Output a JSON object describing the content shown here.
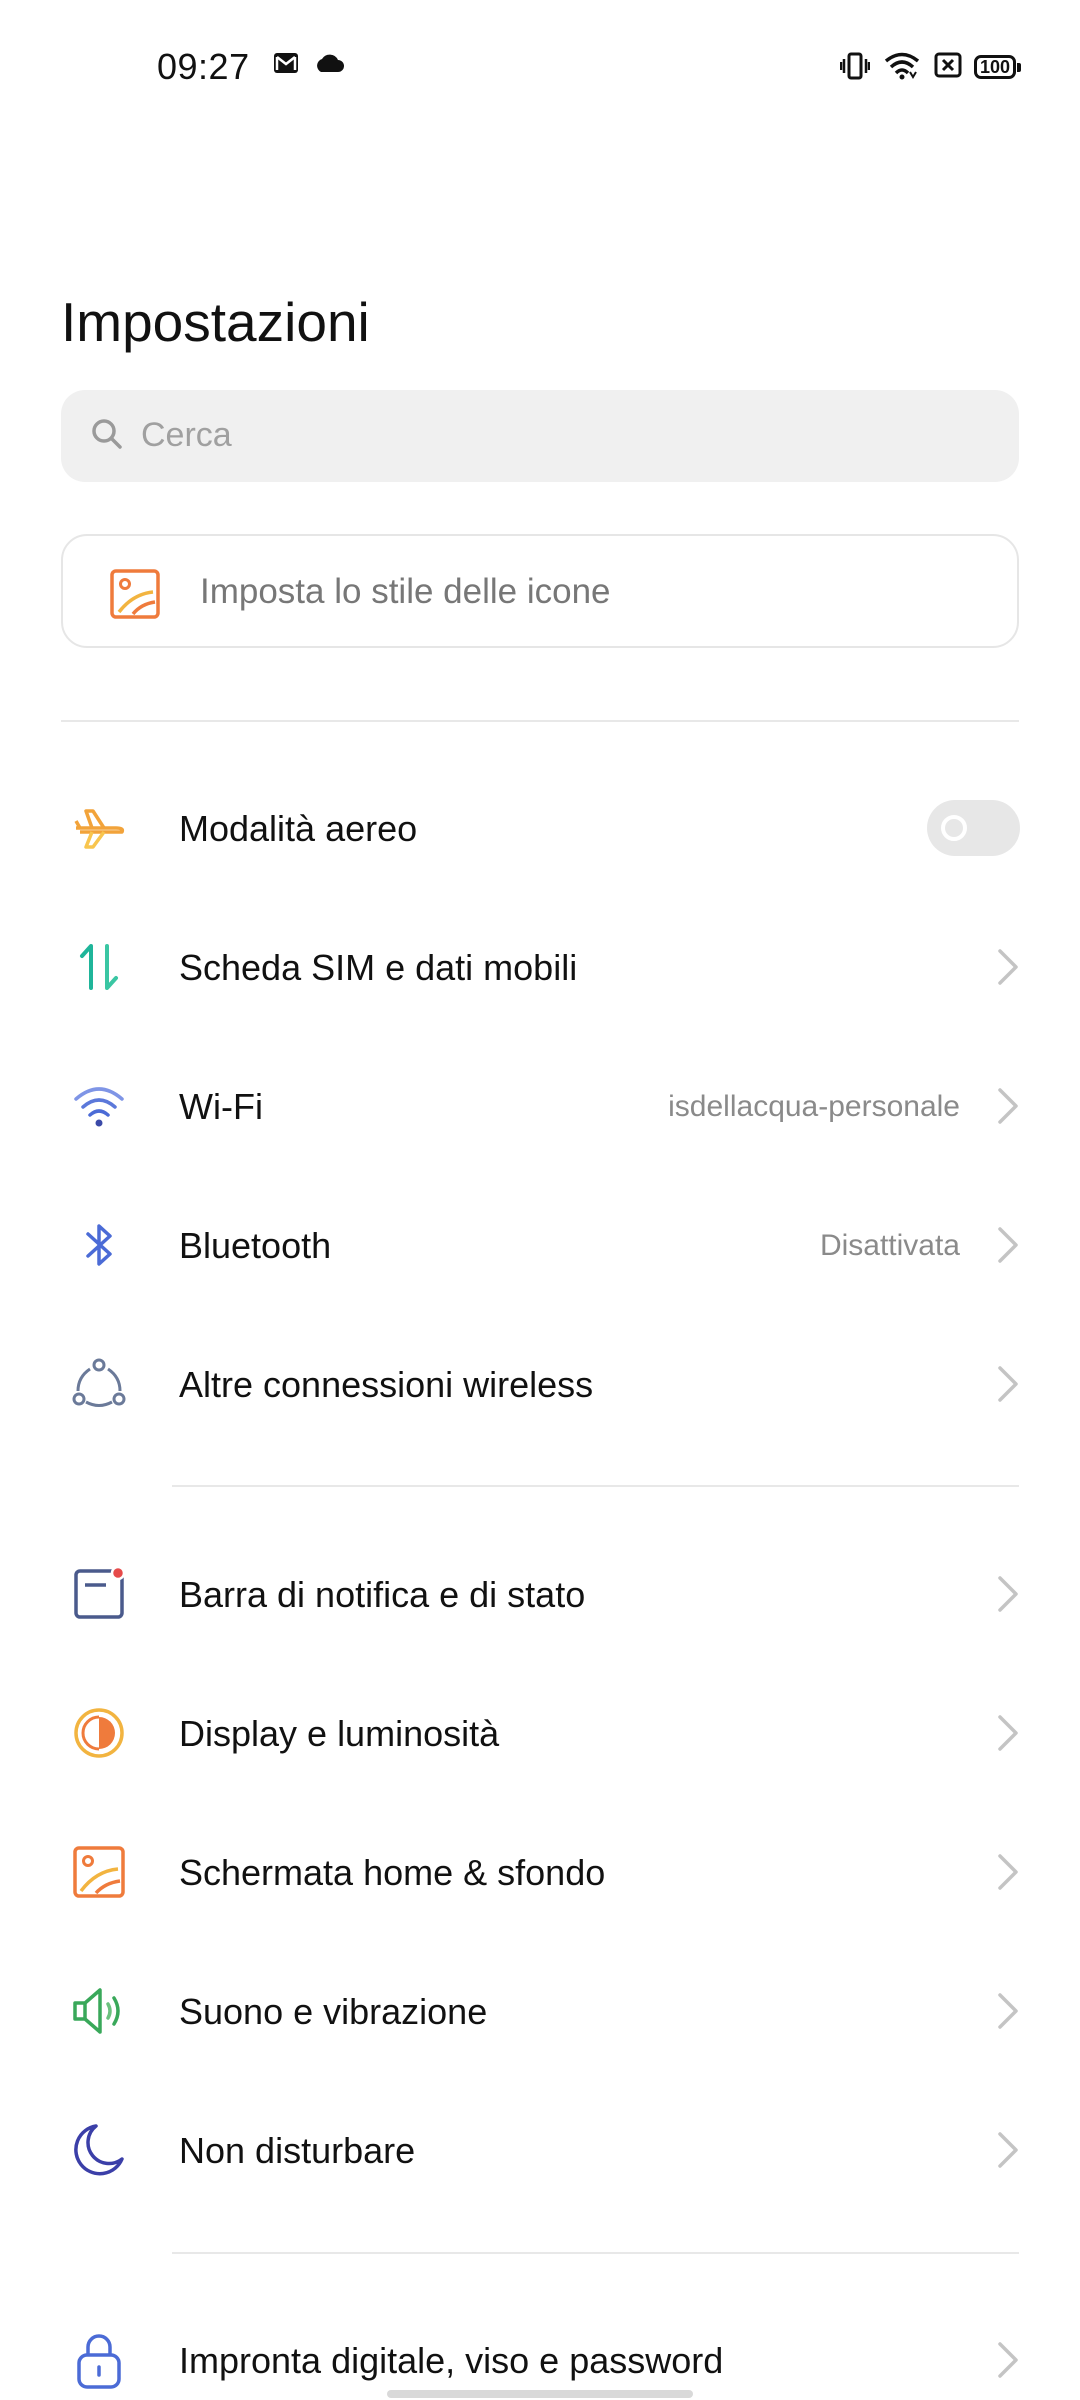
{
  "status_bar": {
    "time": "09:27",
    "left_icons": [
      "gmail-icon",
      "cloud-icon"
    ],
    "right_icons": [
      "vibrate-icon",
      "wifi-icon",
      "no-sim-icon",
      "battery-icon"
    ],
    "battery": "100"
  },
  "header": {
    "title": "Impostazioni"
  },
  "search": {
    "placeholder": "Cerca"
  },
  "icon_style_card": {
    "label": "Imposta lo stile delle icone",
    "icon": "wallpaper-icon"
  },
  "settings": {
    "group1": [
      {
        "label": "Modalità aereo",
        "icon": "airplane-icon",
        "toggle_on": false,
        "icon_color": "#f2a33a"
      },
      {
        "label": "Scheda SIM e dati mobili",
        "icon": "data-transfer-icon",
        "icon_color": "#1fb59a"
      },
      {
        "label": "Wi-Fi",
        "value": "isdellacqua-personale",
        "icon": "wifi-icon",
        "icon_color": "#4b6bd6"
      },
      {
        "label": "Bluetooth",
        "value": "Disattivata",
        "icon": "bluetooth-icon",
        "icon_color": "#4b6bd6"
      },
      {
        "label": "Altre connessioni wireless",
        "icon": "connections-icon",
        "icon_color": "#6b7a99"
      }
    ],
    "group2": [
      {
        "label": "Barra di notifica e di stato",
        "icon": "notification-bar-icon",
        "icon_color": "#4a5a8c"
      },
      {
        "label": "Display e luminosità",
        "icon": "brightness-icon",
        "icon_color": "#f0a030"
      },
      {
        "label": "Schermata home & sfondo",
        "icon": "wallpaper-icon",
        "icon_color": "#ef7b3c"
      },
      {
        "label": "Suono e vibrazione",
        "icon": "speaker-icon",
        "icon_color": "#39a85a"
      },
      {
        "label": "Non disturbare",
        "icon": "moon-icon",
        "icon_color": "#3b3fa8"
      }
    ],
    "group3": [
      {
        "label": "Impronta digitale, viso e password",
        "icon": "lock-icon",
        "icon_color": "#4b6bd6"
      }
    ]
  }
}
